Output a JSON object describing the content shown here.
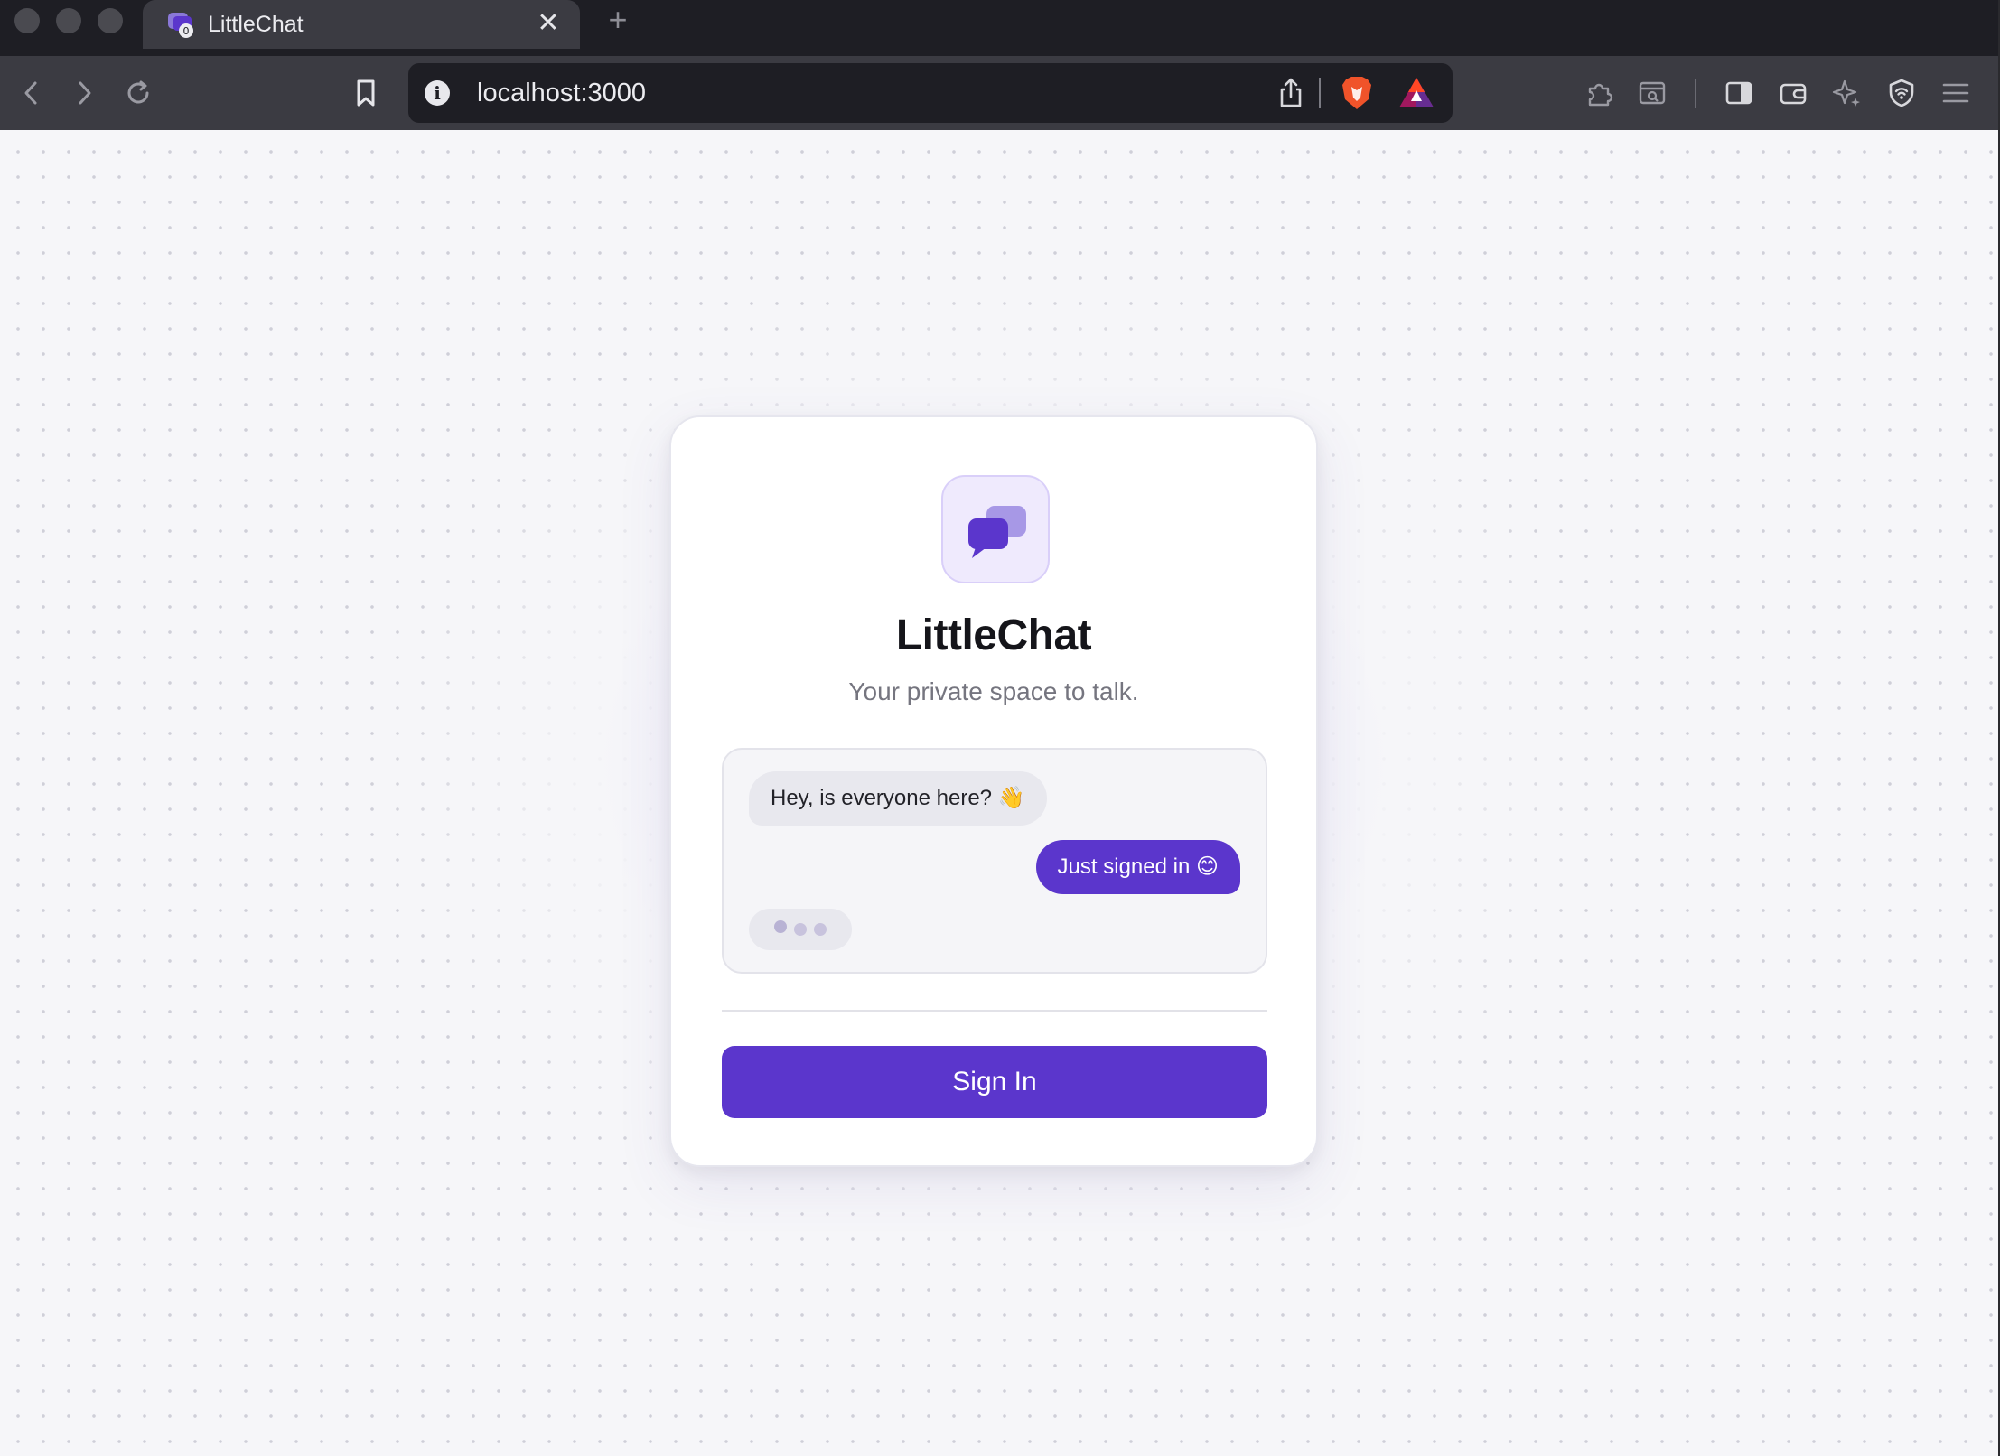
{
  "browser": {
    "tab": {
      "title": "LittleChat",
      "favicon": "littlechat-favicon",
      "badge": "0",
      "close_icon": "close-icon"
    },
    "new_tab_icon": "plus-icon",
    "toolbar": {
      "back_icon": "chevron-left-icon",
      "forward_icon": "chevron-right-icon",
      "reload_icon": "reload-icon",
      "bookmark_icon": "bookmark-icon",
      "url": "localhost:3000",
      "info_icon": "i",
      "share_icon": "share-icon",
      "brave_shields_icon": "brave-lion-icon",
      "rewards_icon": "bat-triangle-icon",
      "right_icons": [
        "extensions-icon",
        "reader-icon",
        "sidebar-icon",
        "wallet-icon",
        "leo-ai-icon",
        "vpn-icon",
        "menu-icon"
      ]
    }
  },
  "login": {
    "logo_icon": "chat-bubbles-icon",
    "title": "LittleChat",
    "subtitle": "Your private space to talk.",
    "preview": {
      "incoming_message": "Hey, is everyone here? 👋",
      "outgoing_message": "Just signed in 😊",
      "typing_indicator": "typing-dots"
    },
    "signin_label": "Sign In"
  },
  "colors": {
    "accent": "#5b36cc",
    "logo_bg": "#efeafd",
    "page_bg": "#f6f6f9",
    "chrome_dark": "#1e1e24",
    "chrome_mid": "#3b3b42"
  }
}
